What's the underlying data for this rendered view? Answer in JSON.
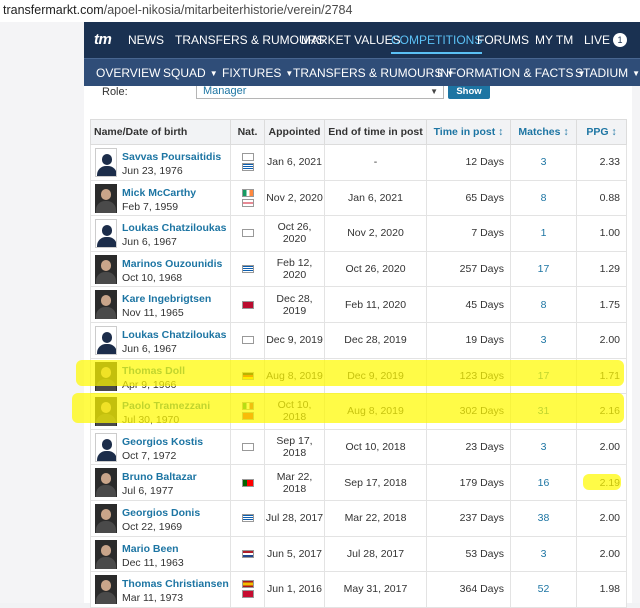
{
  "browser": {
    "url_host": "transfermarkt.com",
    "url_path": "/apoel-nikosia/mitarbeiterhistorie/verein/2784"
  },
  "topnav": {
    "logo": "tm",
    "items": [
      "NEWS",
      "TRANSFERS & RUMOURS",
      "MARKET VALUES",
      "COMPETITIONS",
      "FORUMS",
      "MY TM",
      "LIVE"
    ],
    "live_count": "1"
  },
  "subnav": {
    "items": [
      "OVERVIEW",
      "SQUAD",
      "FIXTURES",
      "TRANSFERS & RUMOURS",
      "INFORMATION & FACTS",
      "STADIUM"
    ]
  },
  "filter": {
    "label": "Role:",
    "selected": "Manager",
    "button": "Show"
  },
  "table": {
    "headers": [
      "Name/Date of birth",
      "Nat.",
      "Appointed",
      "End of time in post",
      "Time in post ↕",
      "Matches ↕",
      "PPG ↕"
    ],
    "rows": [
      {
        "name": "Savvas Poursaitidis",
        "dob": "Jun 23, 1976",
        "flags": [
          "cyprus",
          "greece"
        ],
        "appointed": "Jan 6, 2021",
        "end": "-",
        "time": "12 Days",
        "matches": "3",
        "ppg": "2.33",
        "photo": "silhouette"
      },
      {
        "name": "Mick McCarthy",
        "dob": "Feb 7, 1959",
        "flags": [
          "ireland",
          "england"
        ],
        "appointed": "Nov 2, 2020",
        "end": "Jan 6, 2021",
        "time": "65 Days",
        "matches": "8",
        "ppg": "0.88",
        "photo": "photo"
      },
      {
        "name": "Loukas Chatziloukas",
        "dob": "Jun 6, 1967",
        "flags": [
          "cyprus"
        ],
        "appointed": "Oct 26, 2020",
        "end": "Nov 2, 2020",
        "time": "7 Days",
        "matches": "1",
        "ppg": "1.00",
        "photo": "silhouette"
      },
      {
        "name": "Marinos Ouzounidis",
        "dob": "Oct 10, 1968",
        "flags": [
          "greece"
        ],
        "appointed": "Feb 12, 2020",
        "end": "Oct 26, 2020",
        "time": "257 Days",
        "matches": "17",
        "ppg": "1.29",
        "photo": "photo"
      },
      {
        "name": "Kare Ingebrigtsen",
        "dob": "Nov 11, 1965",
        "flags": [
          "norway"
        ],
        "appointed": "Dec 28, 2019",
        "end": "Feb 11, 2020",
        "time": "45 Days",
        "matches": "8",
        "ppg": "1.75",
        "photo": "photo"
      },
      {
        "name": "Loukas Chatziloukas",
        "dob": "Jun 6, 1967",
        "flags": [
          "cyprus"
        ],
        "appointed": "Dec 9, 2019",
        "end": "Dec 28, 2019",
        "time": "19 Days",
        "matches": "3",
        "ppg": "2.00",
        "photo": "silhouette"
      },
      {
        "name": "Thomas Doll",
        "dob": "Apr 9, 1966",
        "flags": [
          "germany"
        ],
        "appointed": "Aug 8, 2019",
        "end": "Dec 9, 2019",
        "time": "123 Days",
        "matches": "17",
        "ppg": "1.71",
        "photo": "photo"
      },
      {
        "name": "Paolo Tramezzani",
        "dob": "Jul 30, 1970",
        "flags": [
          "italy",
          "albania"
        ],
        "appointed": "Oct 10, 2018",
        "end": "Aug 8, 2019",
        "time": "302 Days",
        "matches": "31",
        "ppg": "2.16",
        "photo": "photo"
      },
      {
        "name": "Georgios Kostis",
        "dob": "Oct 7, 1972",
        "flags": [
          "cyprus"
        ],
        "appointed": "Sep 17, 2018",
        "end": "Oct 10, 2018",
        "time": "23 Days",
        "matches": "3",
        "ppg": "2.00",
        "photo": "silhouette"
      },
      {
        "name": "Bruno Baltazar",
        "dob": "Jul 6, 1977",
        "flags": [
          "portugal"
        ],
        "appointed": "Mar 22, 2018",
        "end": "Sep 17, 2018",
        "time": "179 Days",
        "matches": "16",
        "ppg": "2.19",
        "photo": "photo"
      },
      {
        "name": "Georgios Donis",
        "dob": "Oct 22, 1969",
        "flags": [
          "greece"
        ],
        "appointed": "Jul 28, 2017",
        "end": "Mar 22, 2018",
        "time": "237 Days",
        "matches": "38",
        "ppg": "2.00",
        "photo": "photo"
      },
      {
        "name": "Mario Been",
        "dob": "Dec 11, 1963",
        "flags": [
          "netherlands"
        ],
        "appointed": "Jun 5, 2017",
        "end": "Jul 28, 2017",
        "time": "53 Days",
        "matches": "3",
        "ppg": "2.00",
        "photo": "photo"
      },
      {
        "name": "Thomas Christiansen",
        "dob": "Mar 11, 1973",
        "flags": [
          "spain",
          "denmark"
        ],
        "appointed": "Jun 1, 2016",
        "end": "May 31, 2017",
        "time": "364 Days",
        "matches": "52",
        "ppg": "1.98",
        "photo": "photo"
      }
    ]
  },
  "colors": {
    "header_bg": "#1a3151",
    "subnav_bg": "#2f4d78",
    "link": "#1d75a3",
    "active_nav": "#5bc1f5",
    "highlight": "#fffa00"
  }
}
